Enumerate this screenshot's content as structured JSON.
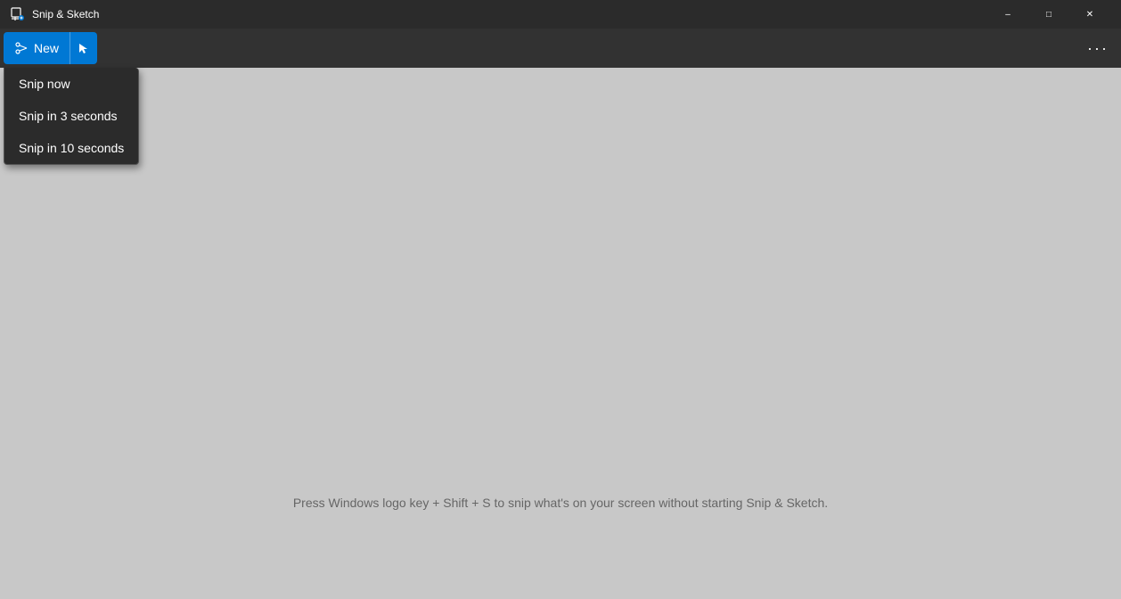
{
  "titlebar": {
    "title": "Snip & Sketch",
    "minimize_label": "–",
    "maximize_label": "□",
    "close_label": "✕"
  },
  "toolbar": {
    "new_button_label": "New",
    "more_label": "···"
  },
  "dropdown": {
    "items": [
      {
        "label": "Snip now",
        "id": "snip-now"
      },
      {
        "label": "Snip in 3 seconds",
        "id": "snip-3"
      },
      {
        "label": "Snip in 10 seconds",
        "id": "snip-10"
      }
    ]
  },
  "main": {
    "hint_text": "Press Windows logo key + Shift + S to snip what's on your screen without starting Snip & Sketch."
  }
}
